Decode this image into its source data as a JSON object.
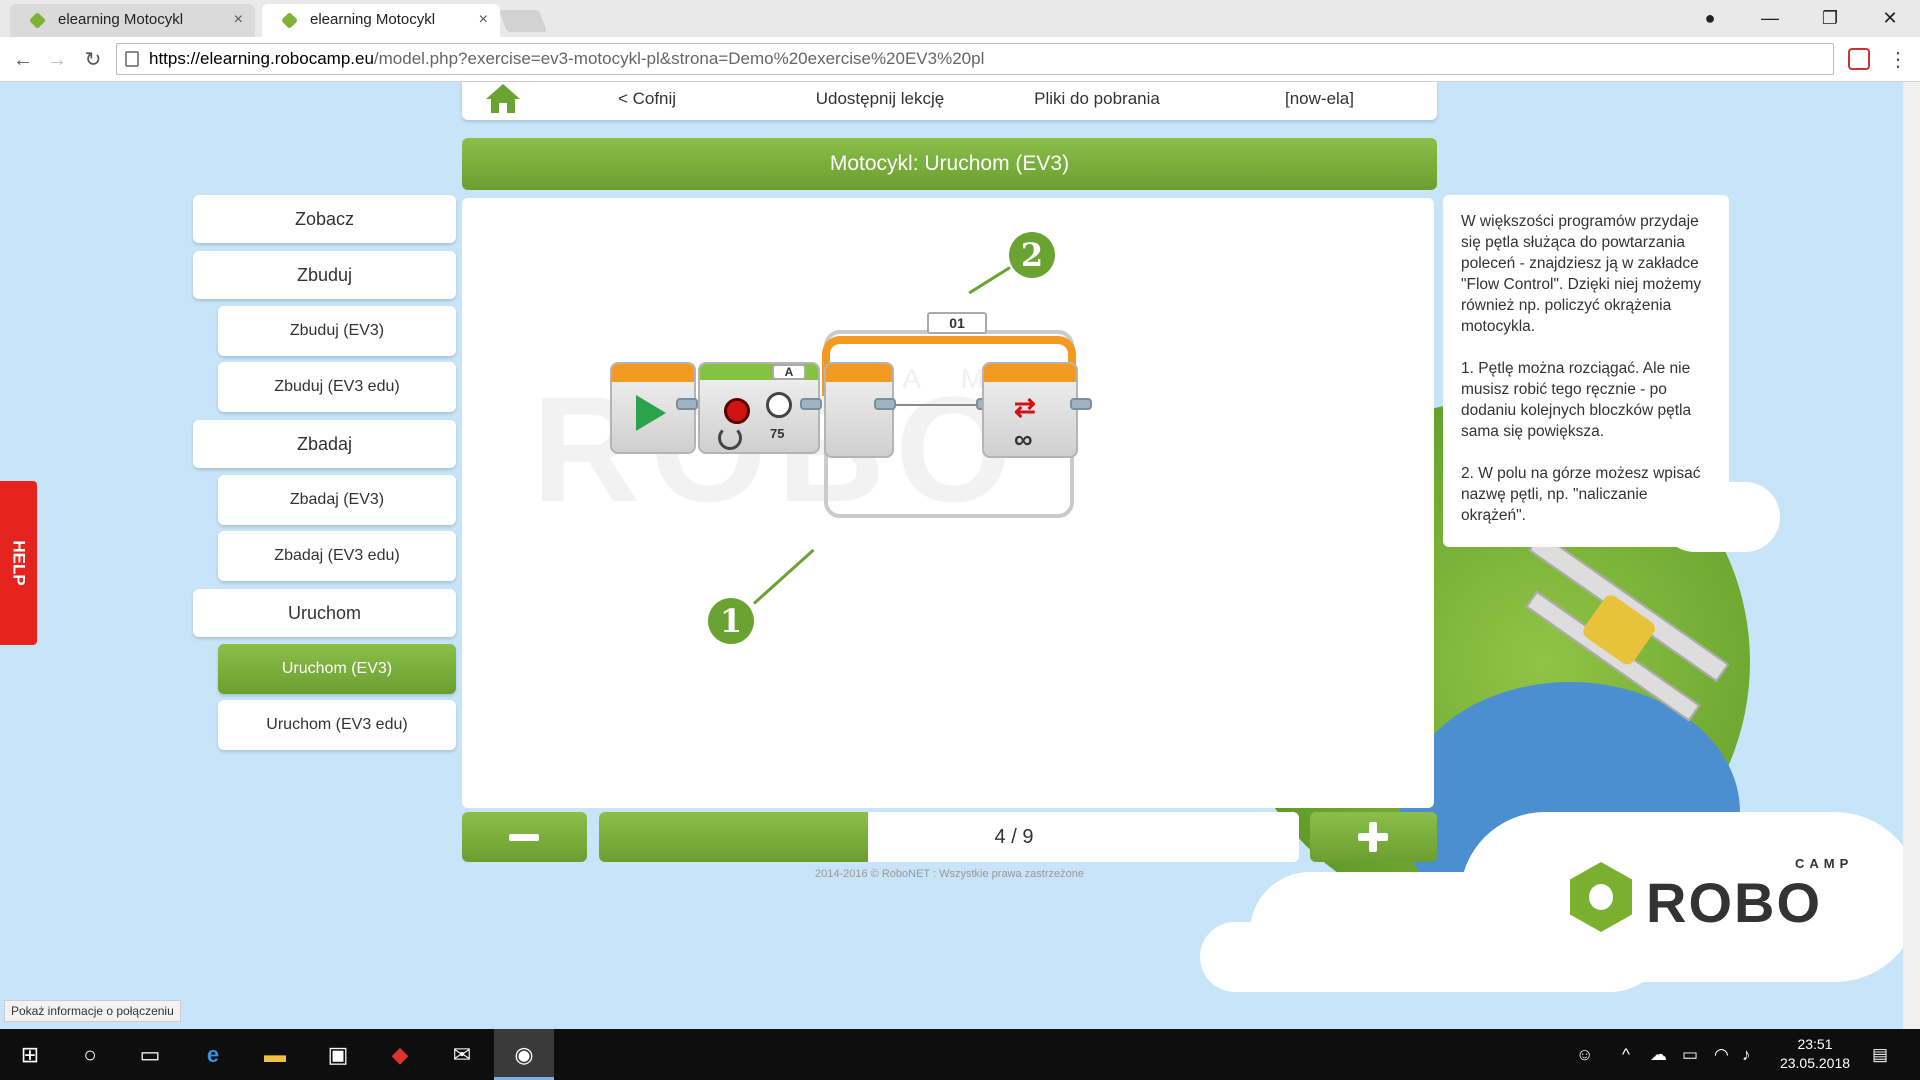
{
  "browser": {
    "tabs": [
      {
        "title": "elearning Motocykl",
        "close": "×"
      },
      {
        "title": "elearning Motocykl",
        "close": "×"
      }
    ],
    "window_controls": {
      "minimize": "—",
      "maximize": "❐",
      "close": "✕",
      "profile": "●"
    },
    "url_host": "https://elearning.robocamp.eu",
    "url_path": "/model.php?exercise=ev3-motocykl-pl&strona=Demo%20exercise%20EV3%20pl",
    "status_text": "Pokaż informacje o połączeniu"
  },
  "topnav": {
    "back": "< Cofnij",
    "share": "Udostępnij lekcję",
    "downloads": "Pliki do pobrania",
    "user": "[now-ela]"
  },
  "title": "Motocykl: Uruchom (EV3)",
  "sidebar": [
    {
      "label": "Zobacz",
      "level": "main",
      "active": false
    },
    {
      "label": "Zbuduj",
      "level": "main",
      "active": false
    },
    {
      "label": "Zbuduj (EV3)",
      "level": "sub",
      "active": false
    },
    {
      "label": "Zbuduj (EV3 edu)",
      "level": "sub",
      "active": false
    },
    {
      "label": "Zbadaj",
      "level": "main",
      "active": false
    },
    {
      "label": "Zbadaj (EV3)",
      "level": "sub",
      "active": false
    },
    {
      "label": "Zbadaj (EV3 edu)",
      "level": "sub",
      "active": false
    },
    {
      "label": "Uruchom",
      "level": "main",
      "active": false
    },
    {
      "label": "Uruchom (EV3)",
      "level": "sub",
      "active": true
    },
    {
      "label": "Uruchom (EV3 edu)",
      "level": "sub",
      "active": false
    }
  ],
  "help_label": "HELP",
  "diagram": {
    "loop_name": "01",
    "port": "A",
    "power": "75",
    "marker_1": "1",
    "marker_2": "2",
    "infinity": "∞"
  },
  "tip_text": "W większości programów przydaje się pętla służąca do powtarzania poleceń - znajdziesz ją w zakładce \"Flow Control\". Dzięki niej możemy również np. policzyć okrążenia motocykla.\n\n1. Pętlę można rozciągać. Ale nie musisz robić tego ręcznie - po dodaniu kolejnych bloczków pętla sama się powiększa.\n\n2. W polu na górze możesz wpisać nazwę pętli, np. \"naliczanie okrążeń\".",
  "progress": {
    "label": "4 / 9",
    "current": 4,
    "total": 9
  },
  "footer": "2014-2016 © RoboNET : Wszystkie prawa zastrzeżone",
  "logo": {
    "word": "ROBO",
    "camp": "CAMP"
  },
  "taskbar": {
    "time": "23:51",
    "date": "23.05.2018"
  },
  "colors": {
    "accent_green": "#7ab030",
    "help_red": "#e52420",
    "loop_orange": "#f29a21"
  }
}
